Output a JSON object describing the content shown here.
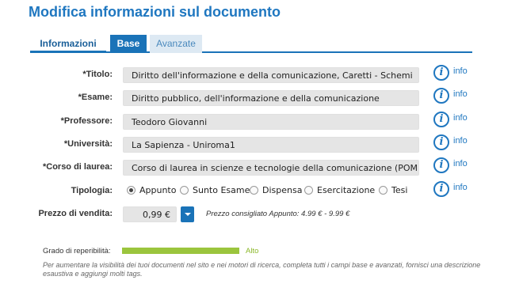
{
  "page": {
    "title": "Modifica informazioni sul documento"
  },
  "tabs": {
    "informazioni": "Informazioni",
    "base": "Base",
    "avanzate": "Avanzate"
  },
  "info_link": {
    "icon": "i",
    "label": "info"
  },
  "fields": {
    "titolo": {
      "label": "*Titolo:",
      "value": "Diritto dell'informazione e della comunicazione, Caretti - Schemi"
    },
    "esame": {
      "label": "*Esame:",
      "value": "Diritto pubblico, dell'informazione e della comunicazione"
    },
    "professore": {
      "label": "*Professore:",
      "value": "Teodoro Giovanni"
    },
    "universita": {
      "label": "*Università:",
      "value": "La Sapienza - Uniroma1"
    },
    "corso": {
      "label": "*Corso di laurea:",
      "value": "Corso di laurea in scienze e tecnologie della comunicazione (POMEZIA, R"
    }
  },
  "tipologia": {
    "label": "Tipologia:",
    "selected": "Appunto",
    "options": [
      "Appunto",
      "Sunto Esame",
      "Dispensa",
      "Esercitazione",
      "Tesi"
    ]
  },
  "prezzo": {
    "label": "Prezzo di vendita:",
    "value": "0,99 €",
    "hint": "Prezzo consigliato Appunto: 4.99 € - 9.99 €"
  },
  "reperibilita": {
    "label": "Grado di reperibilità:",
    "level_fraction": 1.0,
    "value": "Alto",
    "help": "Per aumentare la visibilità dei tuoi documenti nel sito e nei motori di ricerca, completa tutti i campi base e avanzati, fornisci una descrizione esaustiva e aggiungi molti tags."
  },
  "colors": {
    "accent": "#1a73b8",
    "title": "#1f77c0",
    "good": "#9bc53d"
  }
}
